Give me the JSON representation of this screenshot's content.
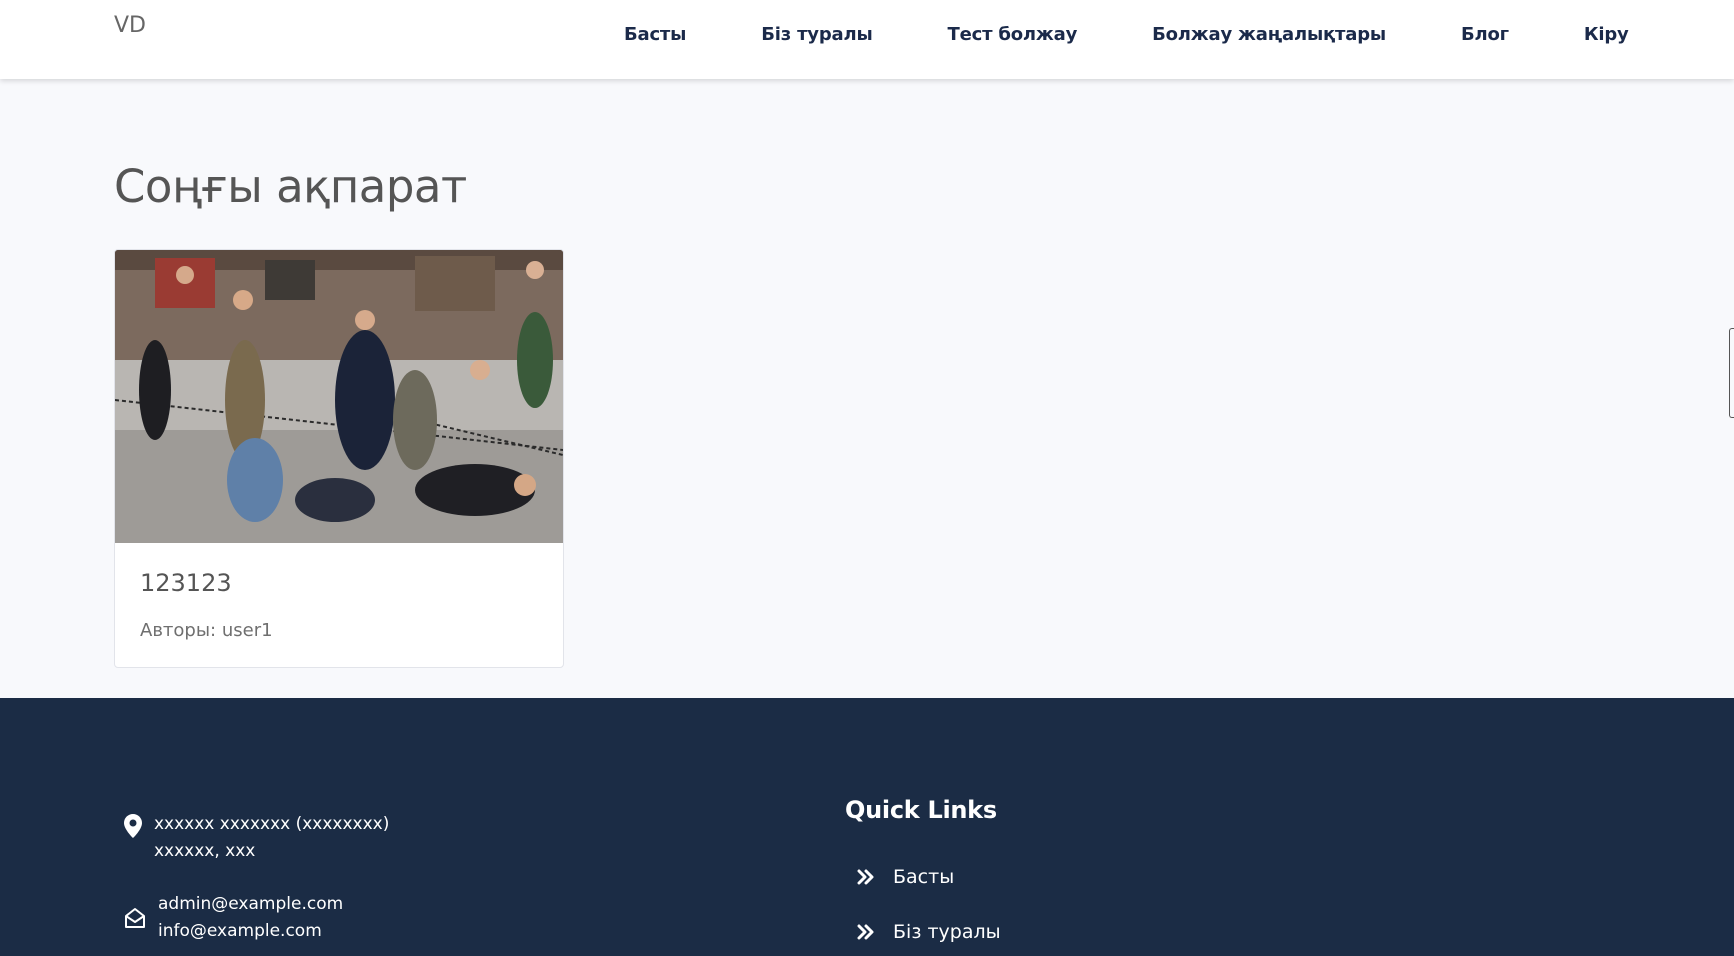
{
  "brand": "VD",
  "nav": {
    "items": [
      "Басты",
      "Біз туралы",
      "Тест болжау",
      "Болжау жаңалықтары",
      "Блог",
      "Кіру"
    ]
  },
  "main": {
    "title": "Соңғы ақпарат",
    "cards": [
      {
        "title": "123123",
        "author": "Авторы: user1",
        "image": "photo of street crowd fight"
      }
    ]
  },
  "footer": {
    "address": "xxxxxx xxxxxxx (xxxxxxxx) xxxxxx, xxx",
    "emails": [
      "admin@example.com",
      "info@example.com"
    ],
    "quick_links_title": "Quick Links",
    "quick_links": [
      "Басты",
      "Біз туралы"
    ]
  },
  "icons": {
    "address": "map-pin-icon",
    "email": "envelope-open-icon",
    "link": "double-chevron-right-icon"
  },
  "colors": {
    "footer_bg": "#1b2c45",
    "nav_text": "#1b2a4a",
    "page_bg": "#f8f9fc"
  }
}
